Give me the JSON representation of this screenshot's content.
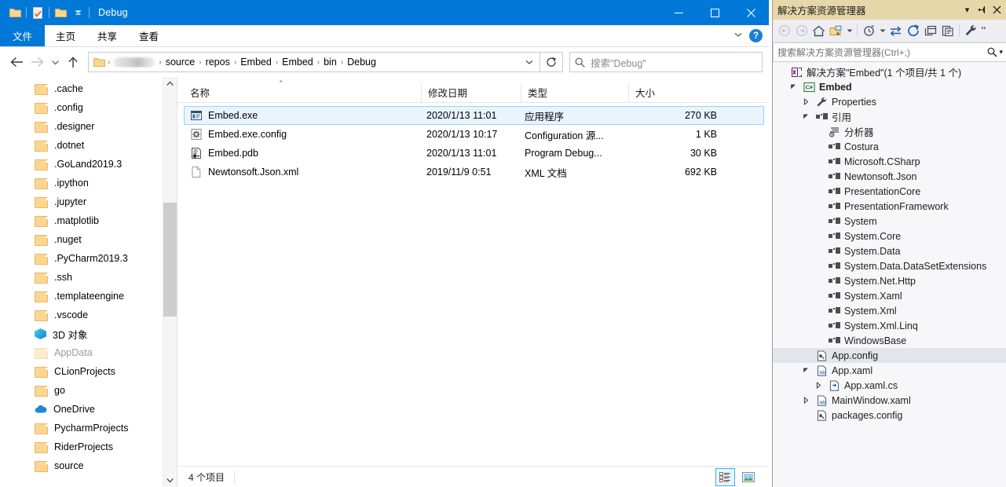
{
  "explorer": {
    "title": "Debug",
    "quick_access": [
      {
        "name": "folder-icon",
        "label": "Folder"
      },
      {
        "name": "properties-icon",
        "label": "Properties"
      },
      {
        "name": "new-folder-icon",
        "label": "New folder"
      },
      {
        "name": "customize-qat-dropdown-icon",
        "label": "Customize"
      }
    ],
    "window_controls": {
      "minimize": "—",
      "maximize": "☐",
      "close": "✕"
    },
    "ribbon_tabs": [
      {
        "label": "文件",
        "active": true
      },
      {
        "label": "主页",
        "active": false
      },
      {
        "label": "共享",
        "active": false
      },
      {
        "label": "查看",
        "active": false
      }
    ],
    "ribbon_right": {
      "expand_label": "∨",
      "help_label": "?"
    },
    "nav_buttons": {
      "back": "←",
      "forward": "→",
      "recent": "∨",
      "up": "↑",
      "refresh": "↻"
    },
    "breadcrumb": {
      "items": [
        "source",
        "repos",
        "Embed",
        "Embed",
        "bin",
        "Debug"
      ],
      "separator": "›",
      "has_redacted_user": true,
      "dropdown": "∨"
    },
    "search": {
      "placeholder": "搜索\"Debug\"",
      "icon": "search-icon"
    },
    "nav_pane": {
      "items": [
        {
          "label": ".cache",
          "icon": "folder-icon",
          "dimmed": false
        },
        {
          "label": ".config",
          "icon": "folder-icon",
          "dimmed": false
        },
        {
          "label": ".designer",
          "icon": "folder-icon",
          "dimmed": false
        },
        {
          "label": ".dotnet",
          "icon": "folder-icon",
          "dimmed": false
        },
        {
          "label": ".GoLand2019.3",
          "icon": "folder-icon",
          "dimmed": false
        },
        {
          "label": ".ipython",
          "icon": "folder-icon",
          "dimmed": false
        },
        {
          "label": ".jupyter",
          "icon": "folder-icon",
          "dimmed": false
        },
        {
          "label": ".matplotlib",
          "icon": "folder-icon",
          "dimmed": false
        },
        {
          "label": ".nuget",
          "icon": "folder-icon",
          "dimmed": false
        },
        {
          "label": ".PyCharm2019.3",
          "icon": "folder-icon",
          "dimmed": false
        },
        {
          "label": ".ssh",
          "icon": "folder-icon",
          "dimmed": false
        },
        {
          "label": ".templateengine",
          "icon": "folder-icon",
          "dimmed": false
        },
        {
          "label": ".vscode",
          "icon": "folder-icon",
          "dimmed": false
        },
        {
          "label": "3D 对象",
          "icon": "3d-objects-icon",
          "dimmed": false
        },
        {
          "label": "AppData",
          "icon": "folder-icon",
          "dimmed": true
        },
        {
          "label": "CLionProjects",
          "icon": "folder-icon",
          "dimmed": false
        },
        {
          "label": "go",
          "icon": "folder-icon",
          "dimmed": false
        },
        {
          "label": "OneDrive",
          "icon": "cloud-icon",
          "dimmed": false
        },
        {
          "label": "PycharmProjects",
          "icon": "folder-icon",
          "dimmed": false
        },
        {
          "label": "RiderProjects",
          "icon": "folder-icon",
          "dimmed": false
        },
        {
          "label": "source",
          "icon": "folder-icon",
          "dimmed": false
        }
      ]
    },
    "columns": [
      {
        "key": "name",
        "label": "名称",
        "sorted": true,
        "sort_mark": "⌃"
      },
      {
        "key": "date",
        "label": "修改日期"
      },
      {
        "key": "type",
        "label": "类型"
      },
      {
        "key": "size",
        "label": "大小"
      }
    ],
    "files": [
      {
        "name": "Embed.exe",
        "date": "2020/1/13 11:01",
        "type": "应用程序",
        "size": "270 KB",
        "icon": "application-icon",
        "selected": true
      },
      {
        "name": "Embed.exe.config",
        "date": "2020/1/13 10:17",
        "type": "Configuration 源...",
        "size": "1 KB",
        "icon": "config-gear-icon",
        "selected": false
      },
      {
        "name": "Embed.pdb",
        "date": "2020/1/13 11:01",
        "type": "Program Debug...",
        "size": "30 KB",
        "icon": "pdb-icon",
        "selected": false
      },
      {
        "name": "Newtonsoft.Json.xml",
        "date": "2019/11/9 0:51",
        "type": "XML 文档",
        "size": "692 KB",
        "icon": "xml-document-icon",
        "selected": false
      }
    ],
    "status": {
      "item_count": "4 个项目"
    },
    "view_buttons": [
      {
        "name": "details-view-button",
        "active": true
      },
      {
        "name": "large-icons-view-button",
        "active": false
      }
    ]
  },
  "vs_panel": {
    "title": "解决方案资源管理器",
    "header_buttons": [
      {
        "name": "dropdown-icon",
        "glyph": "▾"
      },
      {
        "name": "pin-icon",
        "glyph": "⇥"
      },
      {
        "name": "close-icon",
        "glyph": "✕"
      }
    ],
    "toolbar": [
      {
        "name": "back-icon",
        "dim": true
      },
      {
        "name": "forward-icon",
        "dim": true
      },
      {
        "name": "home-icon",
        "dim": false
      },
      {
        "name": "new-folder-icon",
        "dim": false
      },
      {
        "name": "new-folder-dropdown-icon",
        "dim": false
      },
      {
        "name": "pending-changes-icon",
        "dim": false
      },
      {
        "name": "pending-changes-dropdown-icon",
        "dim": false
      },
      {
        "name": "sync-with-active-document-icon",
        "dim": false
      },
      {
        "name": "refresh-icon",
        "dim": false
      },
      {
        "name": "collapse-all-icon",
        "dim": false
      },
      {
        "name": "show-all-files-icon",
        "dim": false
      },
      {
        "name": "properties-wrench-icon",
        "dim": false
      },
      {
        "name": "overflow-icon",
        "dim": false
      }
    ],
    "search": {
      "placeholder": "搜索解决方案资源管理器(Ctrl+;)",
      "icon": "search-icon",
      "dropdown": "▾"
    },
    "tree": [
      {
        "label": "解决方案\"Embed\"(1 个项目/共 1 个)",
        "indent": 0,
        "twist": "",
        "icon": "solution-icon",
        "bold": false,
        "selected": false
      },
      {
        "label": "Embed",
        "indent": 1,
        "twist": "expanded",
        "icon": "csharp-project-icon",
        "bold": true,
        "selected": false
      },
      {
        "label": "Properties",
        "indent": 2,
        "twist": "collapsed",
        "icon": "wrench-icon",
        "bold": false,
        "selected": false
      },
      {
        "label": "引用",
        "indent": 2,
        "twist": "expanded",
        "icon": "references-icon",
        "bold": false,
        "selected": false
      },
      {
        "label": "分析器",
        "indent": 3,
        "twist": "",
        "icon": "analyzers-icon",
        "bold": false,
        "selected": false
      },
      {
        "label": "Costura",
        "indent": 3,
        "twist": "",
        "icon": "reference-icon",
        "bold": false,
        "selected": false
      },
      {
        "label": "Microsoft.CSharp",
        "indent": 3,
        "twist": "",
        "icon": "reference-icon",
        "bold": false,
        "selected": false
      },
      {
        "label": "Newtonsoft.Json",
        "indent": 3,
        "twist": "",
        "icon": "reference-icon",
        "bold": false,
        "selected": false
      },
      {
        "label": "PresentationCore",
        "indent": 3,
        "twist": "",
        "icon": "reference-icon",
        "bold": false,
        "selected": false
      },
      {
        "label": "PresentationFramework",
        "indent": 3,
        "twist": "",
        "icon": "reference-icon",
        "bold": false,
        "selected": false
      },
      {
        "label": "System",
        "indent": 3,
        "twist": "",
        "icon": "reference-icon",
        "bold": false,
        "selected": false
      },
      {
        "label": "System.Core",
        "indent": 3,
        "twist": "",
        "icon": "reference-icon",
        "bold": false,
        "selected": false
      },
      {
        "label": "System.Data",
        "indent": 3,
        "twist": "",
        "icon": "reference-icon",
        "bold": false,
        "selected": false
      },
      {
        "label": "System.Data.DataSetExtensions",
        "indent": 3,
        "twist": "",
        "icon": "reference-icon",
        "bold": false,
        "selected": false
      },
      {
        "label": "System.Net.Http",
        "indent": 3,
        "twist": "",
        "icon": "reference-icon",
        "bold": false,
        "selected": false
      },
      {
        "label": "System.Xaml",
        "indent": 3,
        "twist": "",
        "icon": "reference-icon",
        "bold": false,
        "selected": false
      },
      {
        "label": "System.Xml",
        "indent": 3,
        "twist": "",
        "icon": "reference-icon",
        "bold": false,
        "selected": false
      },
      {
        "label": "System.Xml.Linq",
        "indent": 3,
        "twist": "",
        "icon": "reference-icon",
        "bold": false,
        "selected": false
      },
      {
        "label": "WindowsBase",
        "indent": 3,
        "twist": "",
        "icon": "reference-icon",
        "bold": false,
        "selected": false
      },
      {
        "label": "App.config",
        "indent": 2,
        "twist": "",
        "icon": "config-file-icon",
        "bold": false,
        "selected": true
      },
      {
        "label": "App.xaml",
        "indent": 2,
        "twist": "expanded",
        "icon": "xaml-file-icon",
        "bold": false,
        "selected": false
      },
      {
        "label": "App.xaml.cs",
        "indent": 3,
        "twist": "collapsed",
        "icon": "csharp-file-icon",
        "bold": false,
        "selected": false
      },
      {
        "label": "MainWindow.xaml",
        "indent": 2,
        "twist": "collapsed",
        "icon": "xaml-file-icon",
        "bold": false,
        "selected": false
      },
      {
        "label": "packages.config",
        "indent": 2,
        "twist": "",
        "icon": "config-file-icon",
        "bold": false,
        "selected": false
      }
    ]
  },
  "colors": {
    "title_bar": "#0078d7",
    "vs_header": "#e6d6a8",
    "selection": "#eaf4fd",
    "selection_border": "#99d1ff",
    "folder": "#fcd690"
  }
}
